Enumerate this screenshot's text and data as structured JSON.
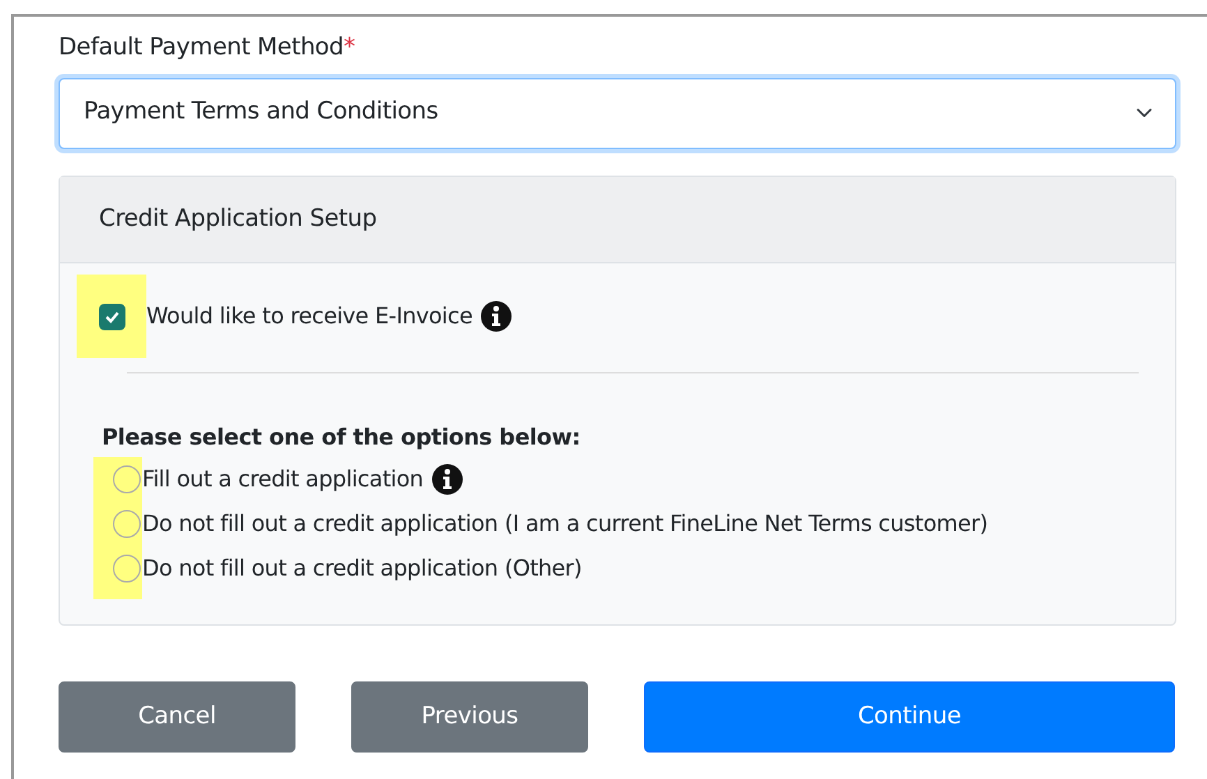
{
  "payment_method": {
    "label": "Default Payment Method",
    "required_mark": "*",
    "value": "Payment Terms and Conditions"
  },
  "credit_setup": {
    "title": "Credit Application Setup",
    "e_invoice": {
      "label": "Would like to receive E-Invoice",
      "checked": true,
      "highlighted": true,
      "info": true
    },
    "options_prompt": "Please select one of the options below:",
    "options_highlighted": true,
    "options": [
      {
        "label": "Fill out a credit application",
        "selected": false,
        "info": true
      },
      {
        "label": "Do not fill out a credit application (I am a current FineLine Net Terms customer)",
        "selected": false,
        "info": false
      },
      {
        "label": "Do not fill out a credit application (Other)",
        "selected": false,
        "info": false
      }
    ]
  },
  "buttons": [
    {
      "label": "Cancel",
      "kind": "secondary"
    },
    {
      "label": "Previous",
      "kind": "secondary"
    },
    {
      "label": "Continue",
      "kind": "primary"
    }
  ]
}
